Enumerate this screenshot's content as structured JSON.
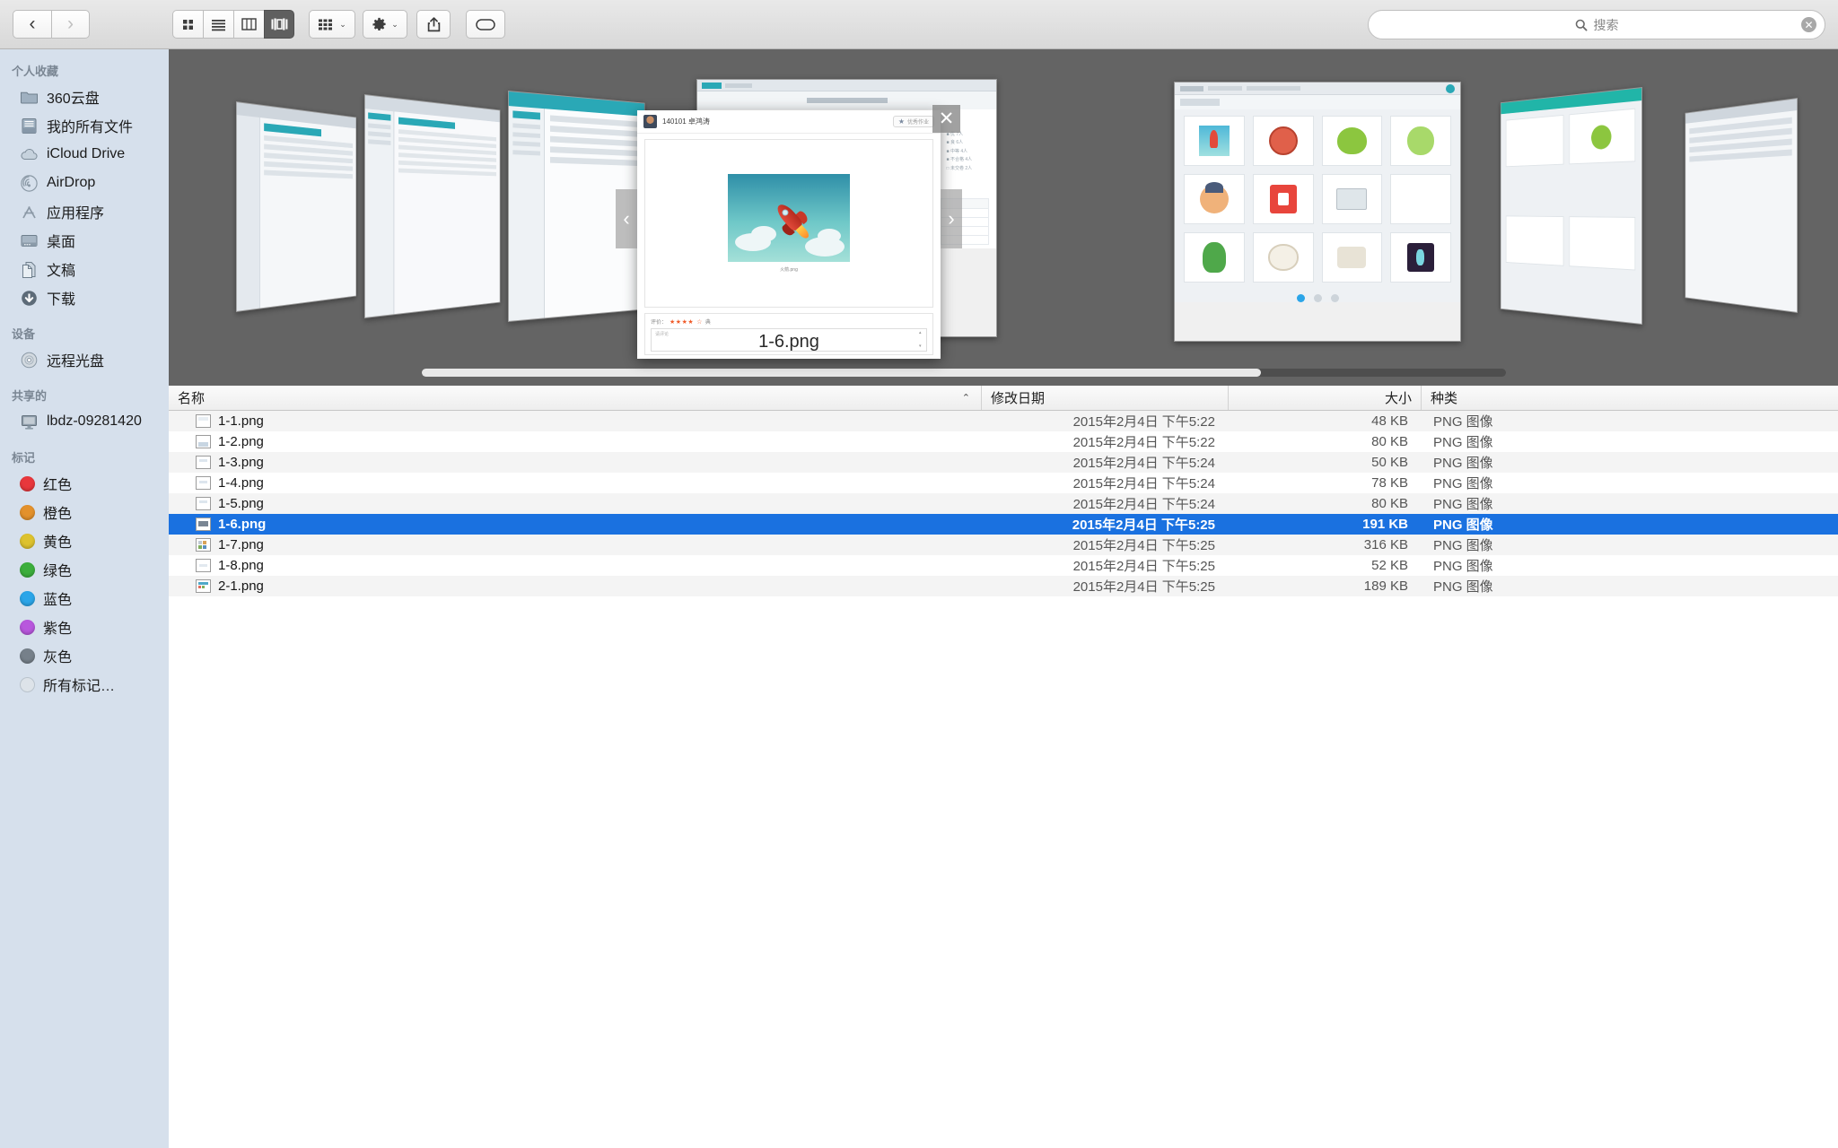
{
  "toolbar": {
    "back_label": "‹",
    "forward_label": "›",
    "view_icon_grid": "icon-view-icon",
    "view_list": "list-view-icon",
    "view_column": "column-view-icon",
    "view_coverflow": "coverflow-view-icon",
    "arrange_label": "arrange-icon",
    "gear_label": "gear-icon",
    "share_label": "share-icon",
    "tag_label": "tag-icon",
    "chevron": "⌄"
  },
  "search": {
    "placeholder": "搜索",
    "value": "",
    "icon": "search-icon",
    "clear_icon": "✕"
  },
  "sidebar": {
    "sections": [
      {
        "title": "个人收藏",
        "items": [
          {
            "label": "360云盘",
            "icon": "folder-icon"
          },
          {
            "label": "我的所有文件",
            "icon": "all-files-icon"
          },
          {
            "label": "iCloud Drive",
            "icon": "cloud-icon"
          },
          {
            "label": "AirDrop",
            "icon": "airdrop-icon"
          },
          {
            "label": "应用程序",
            "icon": "applications-icon"
          },
          {
            "label": "桌面",
            "icon": "desktop-icon"
          },
          {
            "label": "文稿",
            "icon": "documents-icon"
          },
          {
            "label": "下载",
            "icon": "downloads-icon"
          }
        ]
      },
      {
        "title": "设备",
        "items": [
          {
            "label": "远程光盘",
            "icon": "remote-disc-icon"
          }
        ]
      },
      {
        "title": "共享的",
        "items": [
          {
            "label": "lbdz-09281420",
            "icon": "shared-computer-icon"
          }
        ]
      },
      {
        "title": "标记",
        "items": [
          {
            "label": "红色",
            "icon": "tag-dot-icon",
            "color": "#e8373c"
          },
          {
            "label": "橙色",
            "icon": "tag-dot-icon",
            "color": "#e3912c"
          },
          {
            "label": "黄色",
            "icon": "tag-dot-icon",
            "color": "#ddc22e"
          },
          {
            "label": "绿色",
            "icon": "tag-dot-icon",
            "color": "#3cae3c"
          },
          {
            "label": "蓝色",
            "icon": "tag-dot-icon",
            "color": "#2ba5e8"
          },
          {
            "label": "紫色",
            "icon": "tag-dot-icon",
            "color": "#b857dd"
          },
          {
            "label": "灰色",
            "icon": "tag-dot-icon",
            "color": "#76808a"
          },
          {
            "label": "所有标记…",
            "icon": "all-tags-icon",
            "color": "#d6dbe0"
          }
        ]
      }
    ]
  },
  "table": {
    "columns": {
      "name": "名称",
      "date": "修改日期",
      "size": "大小",
      "kind": "种类"
    },
    "sort_caret": "⌃",
    "rows": [
      {
        "name": "1-1.png",
        "date": "2015年2月4日 下午5:22",
        "size": "48 KB",
        "kind": "PNG 图像",
        "selected": false
      },
      {
        "name": "1-2.png",
        "date": "2015年2月4日 下午5:22",
        "size": "80 KB",
        "kind": "PNG 图像",
        "selected": false
      },
      {
        "name": "1-3.png",
        "date": "2015年2月4日 下午5:24",
        "size": "50 KB",
        "kind": "PNG 图像",
        "selected": false
      },
      {
        "name": "1-4.png",
        "date": "2015年2月4日 下午5:24",
        "size": "78 KB",
        "kind": "PNG 图像",
        "selected": false
      },
      {
        "name": "1-5.png",
        "date": "2015年2月4日 下午5:24",
        "size": "80 KB",
        "kind": "PNG 图像",
        "selected": false
      },
      {
        "name": "1-6.png",
        "date": "2015年2月4日 下午5:25",
        "size": "191 KB",
        "kind": "PNG 图像",
        "selected": true
      },
      {
        "name": "1-7.png",
        "date": "2015年2月4日 下午5:25",
        "size": "316 KB",
        "kind": "PNG 图像",
        "selected": false
      },
      {
        "name": "1-8.png",
        "date": "2015年2月4日 下午5:25",
        "size": "52 KB",
        "kind": "PNG 图像",
        "selected": false
      },
      {
        "name": "2-1.png",
        "date": "2015年2月4日 下午5:25",
        "size": "189 KB",
        "kind": "PNG 图像",
        "selected": false
      }
    ]
  },
  "quicklook": {
    "user_name": "140101 卓鸿涛",
    "avatar_icon": "user-avatar",
    "favorite_label": "优秀作业",
    "star_icon": "★",
    "image_caption": "火箭.png",
    "rating_label": "评价：",
    "rating_stars_on": "★★★★",
    "rating_stars_off": "☆",
    "rating_suffix": "典",
    "comment_placeholder": "请评论",
    "filename": "1-6.png",
    "prev_arrow": "‹",
    "next_arrow": "›",
    "close_icon": "✕"
  }
}
